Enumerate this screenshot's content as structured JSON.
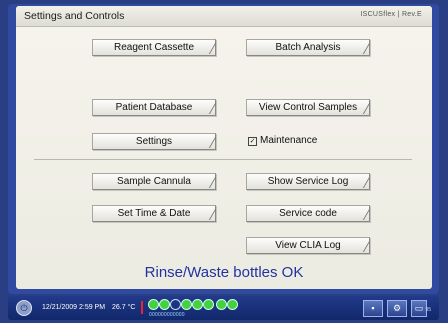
{
  "header": {
    "title": "Settings and Controls",
    "brand": "ISCUSflex | Rev.E"
  },
  "buttons": {
    "reagent_cassette": "Reagent Cassette",
    "batch_analysis": "Batch Analysis",
    "patient_database": "Patient Database",
    "view_control_samples": "View Control Samples",
    "settings": "Settings",
    "sample_cannula": "Sample Cannula",
    "show_service_log": "Show Service Log",
    "set_time_date": "Set Time & Date",
    "service_code": "Service code",
    "view_clia_log": "View CLIA Log"
  },
  "maintenance": {
    "label": "Maintenance",
    "checked": true,
    "check_glyph": "✓"
  },
  "status_message": "Rinse/Waste bottles OK",
  "taskbar": {
    "datetime": "12/21/2009 2:59 PM",
    "temperature": "26.7 °C",
    "power_glyph": "⏻",
    "mini_label": "000000000000",
    "version": "95"
  }
}
